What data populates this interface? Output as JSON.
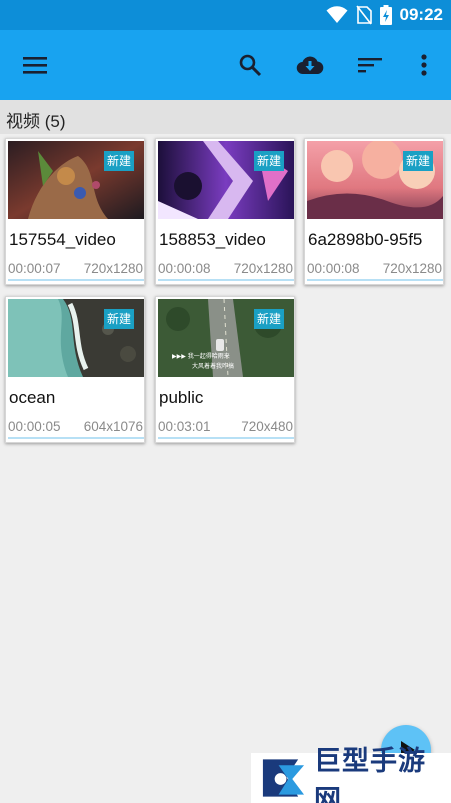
{
  "status_bar": {
    "time": "09:22",
    "icons": [
      "wifi-icon",
      "no-sim-icon",
      "battery-charging-icon"
    ]
  },
  "toolbar": {
    "menu_icon": "menu-icon",
    "search_icon": "search-icon",
    "cloud_icon": "cloud-download-icon",
    "sort_icon": "sort-icon",
    "more_icon": "more-vert-icon",
    "color": "#18a3f0"
  },
  "section": {
    "title": "视频 (5)"
  },
  "videos": [
    {
      "name": "157554_video",
      "duration": "00:00:07",
      "resolution": "720x1280",
      "badge": "新建"
    },
    {
      "name": "158853_video",
      "duration": "00:00:08",
      "resolution": "720x1280",
      "badge": "新建"
    },
    {
      "name": "6a2898b0-95f5",
      "duration": "00:00:08",
      "resolution": "720x1280",
      "badge": "新建"
    },
    {
      "name": "ocean",
      "duration": "00:00:05",
      "resolution": "604x1076",
      "badge": "新建"
    },
    {
      "name": "public",
      "duration": "00:03:01",
      "resolution": "720x480",
      "badge": "新建",
      "subtitle_lines": [
        "▶▶▶ 我一起得哈雨来",
        "大风着着我咋搞"
      ]
    }
  ],
  "fab": {
    "icon": "play-icon"
  },
  "watermark": {
    "text": "巨型手游网",
    "logo": "watermark-logo-icon"
  }
}
